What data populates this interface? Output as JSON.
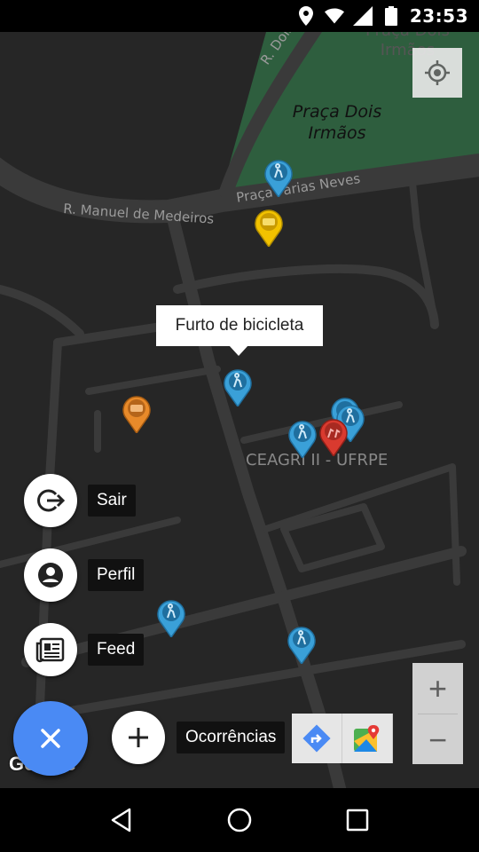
{
  "status_bar": {
    "time": "23:53",
    "icons": [
      "location-icon",
      "wifi-icon",
      "signal-icon",
      "battery-icon"
    ]
  },
  "map": {
    "street_labels": {
      "dois_irmaos_road": "R. Dois Irmãos",
      "manuel_medeiros": "R. Manuel de Medeiros",
      "praca_farias_neves": "Praça Farias Neves"
    },
    "park_label": "Praça Dois Irmãos",
    "park_label_top": "Praça Dois Irmãos",
    "poi_label": "CEAGRI II - UFRPE",
    "info_window": "Furto de bicicleta",
    "google_logo": "Google",
    "colors": {
      "background": "#262626",
      "road": "#3a3a3a",
      "park": "#2e5e3e",
      "marker_blue": "#3aa0d8",
      "marker_yellow": "#f2c200",
      "marker_orange": "#e88a2a",
      "marker_red": "#d93a2f"
    }
  },
  "fab_menu": {
    "items": [
      {
        "label": "Sair",
        "icon": "logout-icon"
      },
      {
        "label": "Perfil",
        "icon": "account-circle-icon"
      },
      {
        "label": "Feed",
        "icon": "newspaper-icon"
      }
    ],
    "add_label": "Ocorrências",
    "main_color": "#4a8af4"
  },
  "zoom": {
    "in": "+",
    "out": "−"
  },
  "nav_bar": {
    "buttons": [
      "back-icon",
      "home-icon",
      "recents-icon"
    ]
  }
}
